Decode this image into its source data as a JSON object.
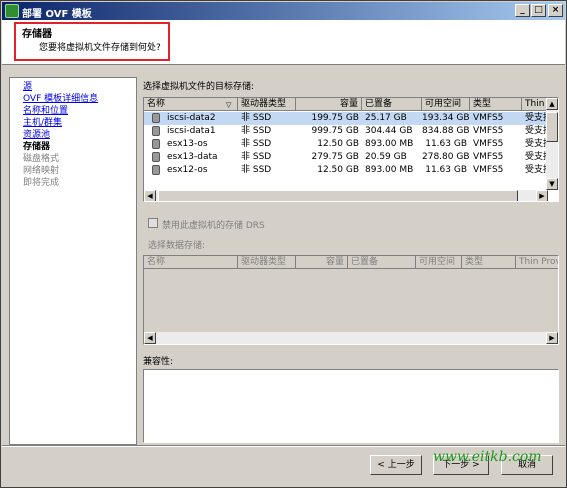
{
  "window": {
    "title": "部署 OVF 模板",
    "controls": [
      "_",
      "□",
      "×"
    ]
  },
  "header": {
    "title": "存储器",
    "subtitle": "您要将虚拟机文件存储到何处?"
  },
  "nav": {
    "items": [
      {
        "label": "源",
        "state": "link"
      },
      {
        "label": "OVF 模板详细信息",
        "state": "link"
      },
      {
        "label": "名称和位置",
        "state": "link"
      },
      {
        "label": "主机/群集",
        "state": "link"
      },
      {
        "label": "资源池",
        "state": "link"
      },
      {
        "label": "存储器",
        "state": "current"
      },
      {
        "label": "磁盘格式",
        "state": "disabled"
      },
      {
        "label": "网络映射",
        "state": "disabled"
      },
      {
        "label": "即将完成",
        "state": "disabled"
      }
    ]
  },
  "storage": {
    "label": "选择虚拟机文件的目标存储:",
    "columns": [
      "名称",
      "驱动器类型",
      "容量",
      "已置备",
      "可用空间",
      "类型",
      "Thin P"
    ],
    "rows": [
      {
        "name": "iscsi-data2",
        "drive": "非 SSD",
        "capacity": "199.75 GB",
        "provisioned": "25.17 GB",
        "free": "193.34 GB",
        "type": "VMFS5",
        "thin": "受支持",
        "selected": true
      },
      {
        "name": "iscsi-data1",
        "drive": "非 SSD",
        "capacity": "999.75 GB",
        "provisioned": "304.44 GB",
        "free": "834.88 GB",
        "type": "VMFS5",
        "thin": "受支持"
      },
      {
        "name": "esx13-os",
        "drive": "非 SSD",
        "capacity": "12.50 GB",
        "provisioned": "893.00 MB",
        "free": "11.63 GB",
        "type": "VMFS5",
        "thin": "受支持"
      },
      {
        "name": "esx13-data",
        "drive": "非 SSD",
        "capacity": "279.75 GB",
        "provisioned": "20.59 GB",
        "free": "278.80 GB",
        "type": "VMFS5",
        "thin": "受支持"
      },
      {
        "name": "esx12-os",
        "drive": "非 SSD",
        "capacity": "12.50 GB",
        "provisioned": "893.00 MB",
        "free": "11.63 GB",
        "type": "VMFS5",
        "thin": "受支持"
      }
    ]
  },
  "drs_checkbox": {
    "label": "禁用此虚拟机的存储 DRS"
  },
  "datastore": {
    "label": "选择数据存储:",
    "columns": [
      "名称",
      "驱动器类型",
      "容量",
      "已置备",
      "可用空间",
      "类型",
      "Thin Provis"
    ]
  },
  "compat": {
    "label": "兼容性:"
  },
  "buttons": {
    "back": "< 上一步",
    "next": "下一步 >",
    "cancel": "取消"
  },
  "watermark": "www.eitkb.com"
}
